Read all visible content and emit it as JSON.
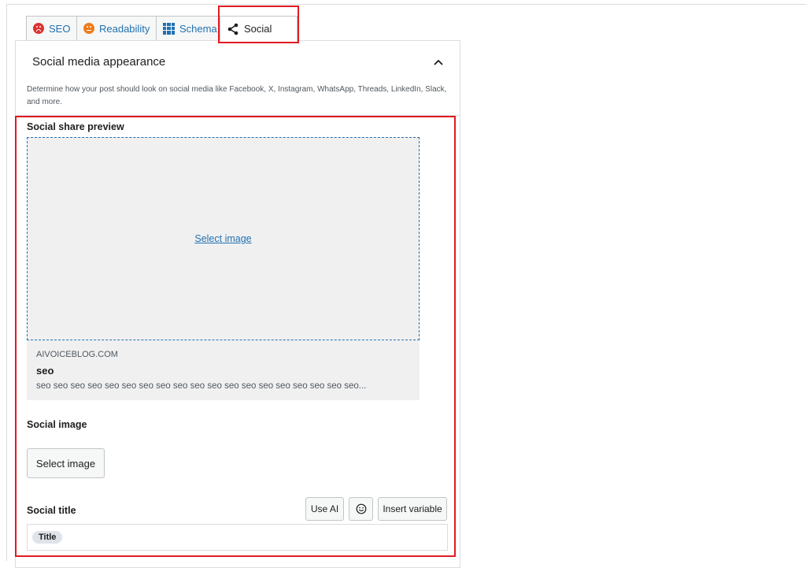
{
  "tabs": [
    {
      "label": "SEO",
      "icon": "sad-face-icon",
      "status_color": "#dc3232"
    },
    {
      "label": "Readability",
      "icon": "neutral-face-icon",
      "status_color": "#ee7c1b"
    },
    {
      "label": "Schema",
      "icon": "grid-icon"
    },
    {
      "label": "Social",
      "icon": "share-icon",
      "active": true
    }
  ],
  "panel": {
    "title": "Social media appearance",
    "description": "Determine how your post should look on social media like Facebook, X, Instagram, WhatsApp, Threads, LinkedIn, Slack, and more."
  },
  "preview": {
    "label": "Social share preview",
    "select_link": "Select image",
    "domain": "AIVOICEBLOG.COM",
    "title": "seo",
    "description": "seo seo seo seo seo seo seo seo seo seo seo seo seo seo seo seo seo seo seo..."
  },
  "social_image": {
    "label": "Social image",
    "button": "Select image"
  },
  "social_title": {
    "label": "Social title",
    "use_ai": "Use AI",
    "emoji_icon": "smiley-icon",
    "insert_variable": "Insert variable",
    "value_pill": "Title"
  },
  "colors": {
    "accent": "#2271b1",
    "highlight": "#e11b22"
  }
}
